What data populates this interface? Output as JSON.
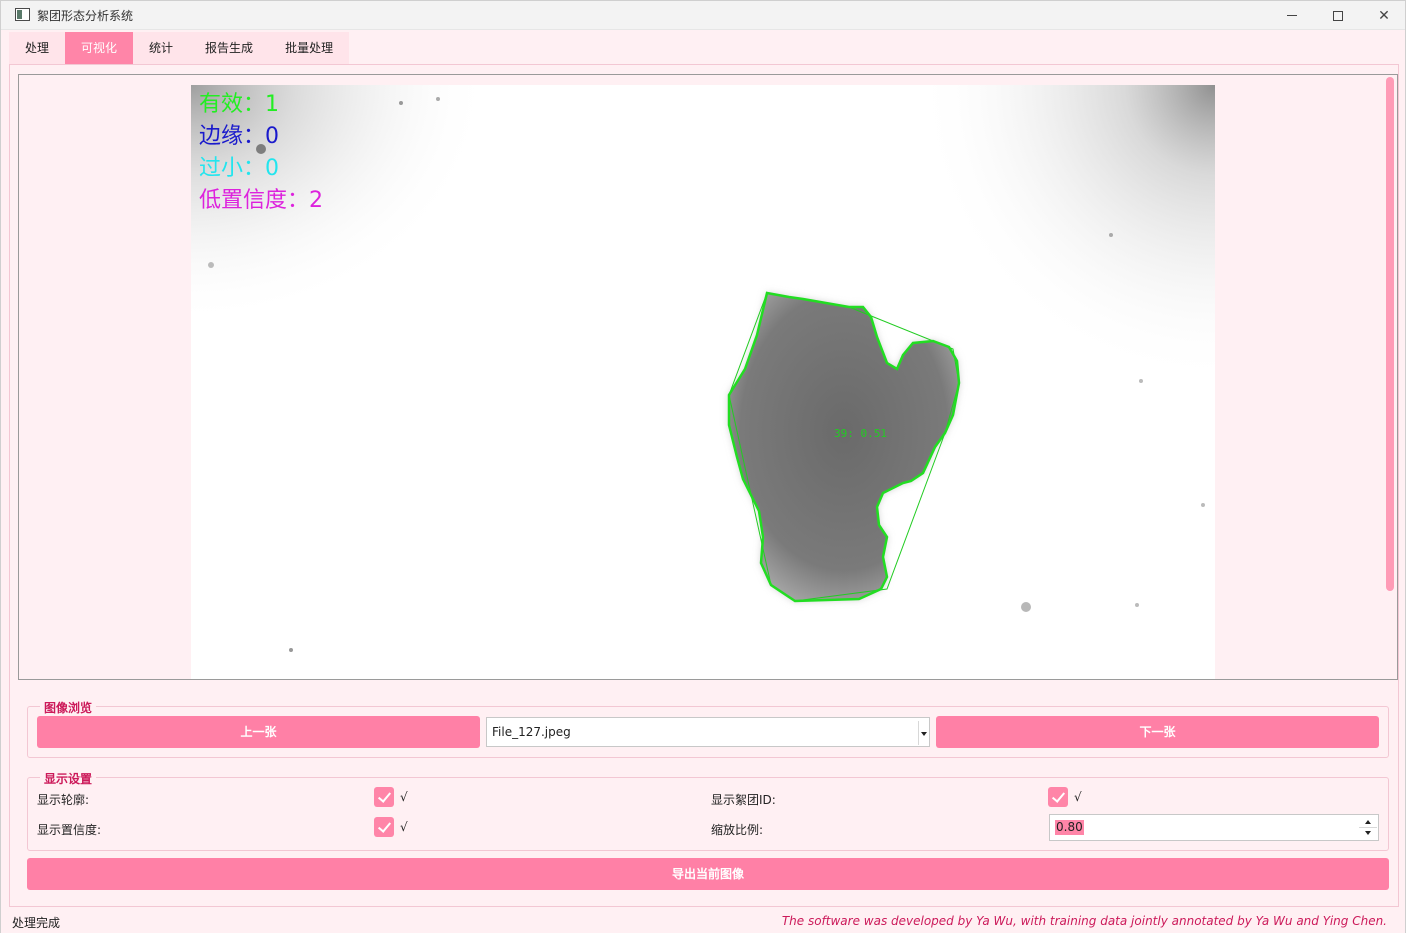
{
  "window": {
    "title": "絮团形态分析系统",
    "minimize_icon": "minimize-icon",
    "maximize_icon": "maximize-icon",
    "close_icon": "close-icon"
  },
  "tabs": [
    {
      "label": "处理",
      "active": false
    },
    {
      "label": "可视化",
      "active": true
    },
    {
      "label": "统计",
      "active": false
    },
    {
      "label": "报告生成",
      "active": false
    },
    {
      "label": "批量处理",
      "active": false
    }
  ],
  "visualization": {
    "overlay": {
      "valid": "有效：1",
      "edge": "边缘：0",
      "too_small": "过小：0",
      "low_confidence": "低置信度：2"
    },
    "floc_label": "39: 0.51",
    "colors": {
      "valid": "#22ee22",
      "edge": "#1a1acc",
      "too_small": "#22e5ee",
      "low_confidence": "#dd22dd",
      "contour": "#22dd22"
    }
  },
  "browse": {
    "title": "图像浏览",
    "prev_label": "上一张",
    "next_label": "下一张",
    "current_file": "File_127.jpeg"
  },
  "display_settings": {
    "title": "显示设置",
    "show_contour": {
      "label": "显示轮廓:",
      "checked": true,
      "text": "√"
    },
    "show_floc_id": {
      "label": "显示絮团ID:",
      "checked": true,
      "text": "√"
    },
    "show_confidence": {
      "label": "显示置信度:",
      "checked": true,
      "text": "√"
    },
    "zoom": {
      "label": "缩放比例:",
      "value": "0.80"
    }
  },
  "export_label": "导出当前图像",
  "status": {
    "message": "处理完成",
    "credit": "The software was developed by Ya Wu, with training data jointly annotated by Ya Wu and Ying Chen."
  },
  "accent_color": "#ff85a8"
}
